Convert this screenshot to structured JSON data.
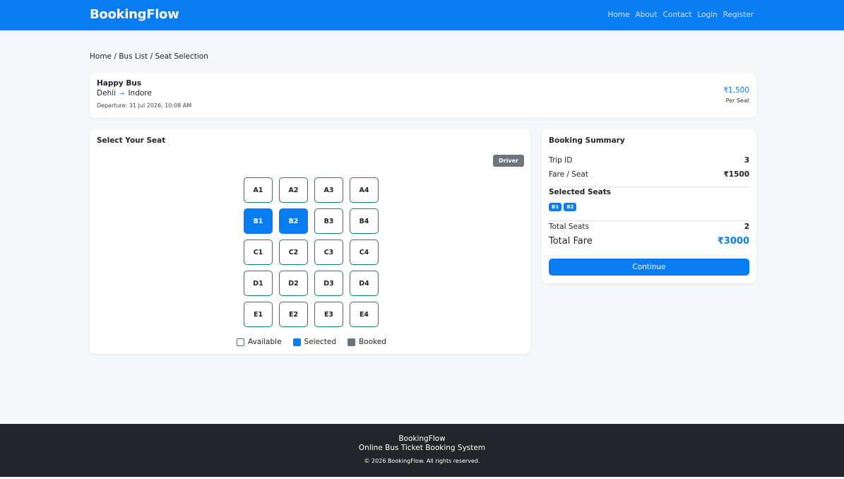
{
  "navbar": {
    "brand": "BookingFlow",
    "links": [
      "Home",
      "About",
      "Contact",
      "Login",
      "Register"
    ]
  },
  "breadcrumb": "Home / Bus List / Seat Selection",
  "trip": {
    "bus_name": "Happy Bus",
    "from": "Dehli",
    "to": "Indore",
    "arrow": "→",
    "departure": "Departure: 31 Jul 2026, 10:08 AM",
    "price": "₹1,500",
    "per_seat": "Per Seat"
  },
  "seat_section": {
    "title": "Select Your Seat",
    "driver_label": "Driver",
    "rows": [
      [
        {
          "id": "A1",
          "status": "available"
        },
        {
          "id": "A2",
          "status": "available"
        },
        {
          "id": "A3",
          "status": "available"
        },
        {
          "id": "A4",
          "status": "available"
        }
      ],
      [
        {
          "id": "B1",
          "status": "selected"
        },
        {
          "id": "B2",
          "status": "selected"
        },
        {
          "id": "B3",
          "status": "available"
        },
        {
          "id": "B4",
          "status": "available"
        }
      ],
      [
        {
          "id": "C1",
          "status": "available"
        },
        {
          "id": "C2",
          "status": "available"
        },
        {
          "id": "C3",
          "status": "available"
        },
        {
          "id": "C4",
          "status": "available"
        }
      ],
      [
        {
          "id": "D1",
          "status": "available"
        },
        {
          "id": "D2",
          "status": "available"
        },
        {
          "id": "D3",
          "status": "available"
        },
        {
          "id": "D4",
          "status": "available"
        }
      ],
      [
        {
          "id": "E1",
          "status": "available"
        },
        {
          "id": "E2",
          "status": "available"
        },
        {
          "id": "E3",
          "status": "available"
        },
        {
          "id": "E4",
          "status": "available"
        }
      ]
    ],
    "legend": {
      "available": "Available",
      "selected": "Selected",
      "booked": "Booked"
    }
  },
  "summary": {
    "title": "Booking Summary",
    "trip_id_label": "Trip ID",
    "trip_id": "3",
    "fare_label": "Fare / Seat",
    "fare": "₹1500",
    "selected_seats_label": "Selected Seats",
    "selected_seats": [
      "B1",
      "B2"
    ],
    "total_seats_label": "Total Seats",
    "total_seats": "2",
    "total_fare_label": "Total Fare",
    "total_fare": "₹3000",
    "continue_label": "Continue"
  },
  "footer": {
    "brand": "BookingFlow",
    "tagline": "Online Bus Ticket Booking System",
    "copyright": "© 2026 BookingFlow. All rights reserved."
  },
  "colors": {
    "primary": "#0a7cf2",
    "available_border": "#198754",
    "booked": "#6c757d",
    "footer_bg": "#212529"
  }
}
